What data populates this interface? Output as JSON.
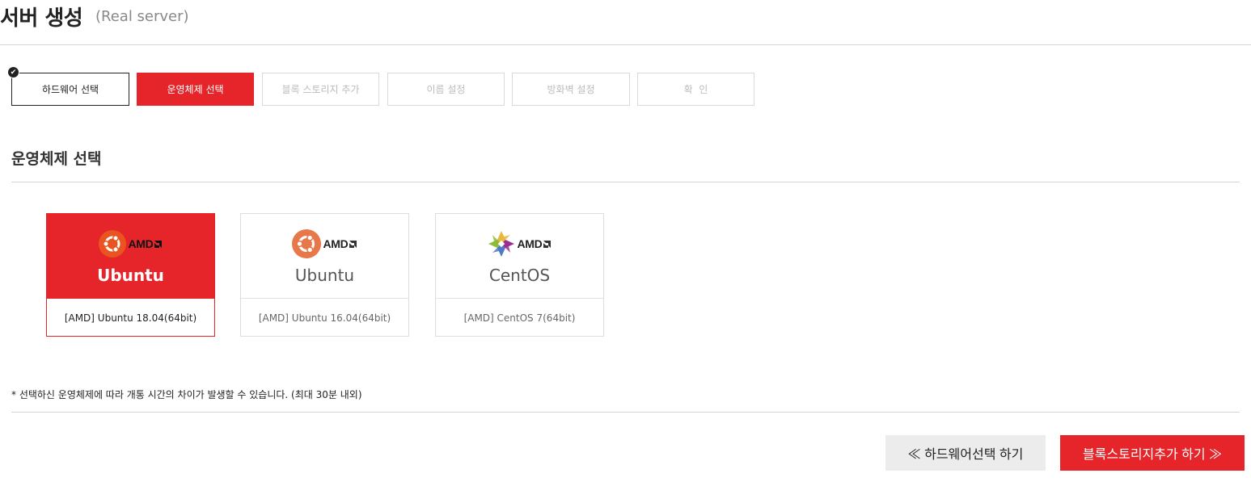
{
  "header": {
    "title": "서버 생성",
    "subtitle": "(Real server)"
  },
  "steps": [
    {
      "label": "하드웨어 선택",
      "state": "done"
    },
    {
      "label": "운영체제 선택",
      "state": "active"
    },
    {
      "label": "블록 스토리지 추가",
      "state": "pending"
    },
    {
      "label": "이름 설정",
      "state": "pending"
    },
    {
      "label": "방화벽 설정",
      "state": "pending"
    },
    {
      "label": "확  인",
      "state": "pending"
    }
  ],
  "section": {
    "title": "운영체제 선택"
  },
  "os_options": [
    {
      "vendor": "AMD",
      "name": "Ubuntu",
      "version": "[AMD] Ubuntu 18.04(64bit)",
      "icon": "ubuntu-logo-icon",
      "selected": true
    },
    {
      "vendor": "AMD",
      "name": "Ubuntu",
      "version": "[AMD] Ubuntu 16.04(64bit)",
      "icon": "ubuntu-logo-icon",
      "selected": false
    },
    {
      "vendor": "AMD",
      "name": "CentOS",
      "version": "[AMD] CentOS 7(64bit)",
      "icon": "centos-logo-icon",
      "selected": false
    }
  ],
  "note": "* 선택하신 운영체제에 따라 개통 시간의 차이가 발생할 수 있습니다. (최대 30분 내외)",
  "buttons": {
    "prev_label": "≪ 하드웨어선택 하기",
    "next_label": "블록스토리지추가 하기 ≫"
  },
  "colors": {
    "accent": "#e5252a",
    "ubuntu_orange": "#e95420"
  }
}
